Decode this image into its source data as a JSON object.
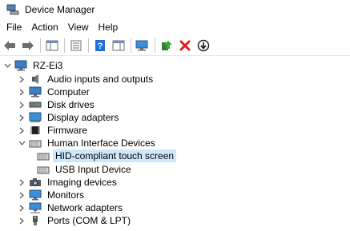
{
  "window": {
    "title": "Device Manager"
  },
  "menu": [
    {
      "label": "File"
    },
    {
      "label": "Action"
    },
    {
      "label": "View"
    },
    {
      "label": "Help"
    }
  ],
  "toolbar": {
    "buttons": [
      {
        "icon": "back-arrow-icon"
      },
      {
        "icon": "forward-arrow-icon"
      },
      {
        "icon": "show-hide-console-tree-icon"
      },
      {
        "icon": "properties-icon"
      },
      {
        "icon": "help-icon"
      },
      {
        "icon": "action-pane-icon"
      },
      {
        "icon": "scan-hardware-changes-icon"
      },
      {
        "icon": "update-driver-icon"
      },
      {
        "icon": "uninstall-device-icon"
      },
      {
        "icon": "disable-device-icon"
      }
    ]
  },
  "tree": {
    "root": {
      "label": "RZ-Ei3",
      "expanded": true
    },
    "items": [
      {
        "label": "Audio inputs and outputs",
        "icon": "speaker-icon",
        "expanded": false
      },
      {
        "label": "Computer",
        "icon": "monitor-icon",
        "expanded": false
      },
      {
        "label": "Disk drives",
        "icon": "disk-drive-icon",
        "expanded": false
      },
      {
        "label": "Display adapters",
        "icon": "display-adapter-icon",
        "expanded": false
      },
      {
        "label": "Firmware",
        "icon": "chip-icon",
        "expanded": false
      },
      {
        "label": "Human Interface Devices",
        "icon": "hid-icon",
        "expanded": true,
        "children": [
          {
            "label": "HID-compliant touch screen",
            "icon": "hid-icon",
            "selected": true
          },
          {
            "label": "USB Input Device",
            "icon": "hid-icon",
            "selected": false
          }
        ]
      },
      {
        "label": "Imaging devices",
        "icon": "camera-icon",
        "expanded": false
      },
      {
        "label": "Monitors",
        "icon": "monitor-icon",
        "expanded": false
      },
      {
        "label": "Network adapters",
        "icon": "network-adapter-icon",
        "expanded": false
      },
      {
        "label": "Ports (COM & LPT)",
        "icon": "port-icon",
        "expanded": false
      }
    ]
  },
  "colors": {
    "selection": "#cce8ff",
    "accent": "#1e6fd9"
  }
}
